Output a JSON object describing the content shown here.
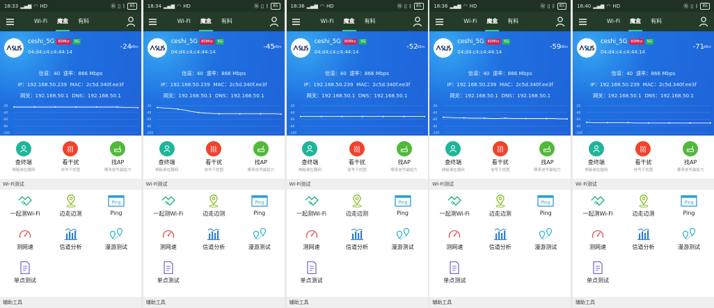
{
  "panels": [
    {
      "status": {
        "time": "18:33",
        "network": "HD",
        "battery": "85"
      },
      "tabs": [
        "Wi-Fi",
        "魔盒",
        "有料"
      ],
      "active_tab": 1,
      "network": {
        "ssid": "ceshi_5G",
        "width_badge": "80Mhz",
        "band_badge": "5G",
        "mac": "04:d4:c4:c4:44:14",
        "rssi": "-24",
        "rssi_unit": "dBm",
        "channel_label": "信道：",
        "channel": "40",
        "rate_label": "速率：",
        "rate": "866 Mbps",
        "ip_label": "IP：",
        "ip": "192.168.50.239",
        "mac_label": "MAC：",
        "bssid": "2c5d.340f.ee3f",
        "gw_label": "网关：",
        "gateway": "192.168.50.1",
        "dns_label": "DNS：",
        "dns": "192.168.50.1"
      },
      "chart_data": {
        "type": "line",
        "y_ticks": [
          "-20",
          "-40",
          "-60",
          "-80",
          "-100"
        ],
        "ylim": [
          -100,
          -20
        ],
        "values": [
          -24,
          -24,
          -24,
          -24,
          -24,
          -24,
          -24,
          -24,
          -24,
          -24,
          -24,
          -24,
          -24,
          -24,
          -24,
          -24,
          -25,
          -25,
          -26
        ]
      }
    },
    {
      "status": {
        "time": "18:34",
        "network": "HD",
        "battery": "85"
      },
      "tabs": [
        "Wi-Fi",
        "魔盒",
        "有料"
      ],
      "active_tab": 1,
      "network": {
        "ssid": "ceshi_5G",
        "width_badge": "80Mhz",
        "band_badge": "5G",
        "mac": "04:d4:c4:c4:44:14",
        "rssi": "-45",
        "rssi_unit": "dBm",
        "channel_label": "信道：",
        "channel": "40",
        "rate_label": "速率：",
        "rate": "866 Mbps",
        "ip_label": "IP：",
        "ip": "192.168.50.239",
        "mac_label": "MAC：",
        "bssid": "2c5d.340f.ee3f",
        "gw_label": "网关：",
        "gateway": "192.168.50.1",
        "dns_label": "DNS：",
        "dns": "192.168.50.1"
      },
      "chart_data": {
        "type": "line",
        "y_ticks": [
          "-20",
          "-40",
          "-60",
          "-80",
          "-100"
        ],
        "ylim": [
          -100,
          -20
        ],
        "values": [
          -25,
          -27,
          -28,
          -30,
          -33,
          -37,
          -40,
          -42,
          -43,
          -44,
          -44,
          -44,
          -44,
          -44,
          -44,
          -44,
          -44,
          -44,
          -45
        ]
      }
    },
    {
      "status": {
        "time": "18:36",
        "network": "HD",
        "battery": "85"
      },
      "tabs": [
        "Wi-Fi",
        "魔盒",
        "有料"
      ],
      "active_tab": 1,
      "network": {
        "ssid": "ceshi_5G",
        "width_badge": "80Mhz",
        "band_badge": "5G",
        "mac": "04:d4:c4:c4:44:14",
        "rssi": "-52",
        "rssi_unit": "dBm",
        "channel_label": "信道：",
        "channel": "40",
        "rate_label": "速率：",
        "rate": "866 Mbps",
        "ip_label": "IP：",
        "ip": "192.168.50.239",
        "mac_label": "MAC：",
        "bssid": "2c5d.340f.ee3f",
        "gw_label": "网关：",
        "gateway": "192.168.50.1",
        "dns_label": "DNS：",
        "dns": "192.168.50.1"
      },
      "chart_data": {
        "type": "line",
        "y_ticks": [
          "-20",
          "-40",
          "-60",
          "-80",
          "-100"
        ],
        "ylim": [
          -100,
          -20
        ],
        "values": [
          -52,
          -52,
          -52,
          -52,
          -52,
          -52,
          -52,
          -52,
          -52,
          -52,
          -52,
          -52,
          -52,
          -52,
          -52,
          -52,
          -52,
          -52,
          -52
        ]
      }
    },
    {
      "status": {
        "time": "18:36",
        "network": "HD",
        "battery": "85"
      },
      "tabs": [
        "Wi-Fi",
        "魔盒",
        "有料"
      ],
      "active_tab": 1,
      "network": {
        "ssid": "ceshi_5G",
        "width_badge": "80Mhz",
        "band_badge": "5G",
        "mac": "04:d4:c4:c4:44:14",
        "rssi": "-59",
        "rssi_unit": "dBm",
        "channel_label": "信道：",
        "channel": "40",
        "rate_label": "速率：",
        "rate": "866 Mbps",
        "ip_label": "IP：",
        "ip": "192.168.50.239",
        "mac_label": "MAC：",
        "bssid": "2c5d.340f.ee3f",
        "gw_label": "网关：",
        "gateway": "192.168.50.1",
        "dns_label": "DNS：",
        "dns": "192.168.50.1"
      },
      "chart_data": {
        "type": "line",
        "y_ticks": [
          "-20",
          "-40",
          "-60",
          "-80",
          "-100"
        ],
        "ylim": [
          -100,
          -20
        ],
        "values": [
          -54,
          -55,
          -56,
          -56,
          -57,
          -57,
          -57,
          -58,
          -58,
          -57,
          -58,
          -58,
          -58,
          -58,
          -58,
          -58,
          -58,
          -59,
          -59
        ]
      }
    },
    {
      "status": {
        "time": "18:40",
        "network": "HD",
        "battery": "85"
      },
      "tabs": [
        "Wi-Fi",
        "魔盒",
        "有料"
      ],
      "active_tab": 1,
      "network": {
        "ssid": "ceshi_5G",
        "width_badge": "80Mhz",
        "band_badge": "5G",
        "mac": "04:d4:c4:c4:44:14",
        "rssi": "-71",
        "rssi_unit": "dBm",
        "channel_label": "信道：",
        "channel": "40",
        "rate_label": "速率：",
        "rate": "866 Mbps",
        "ip_label": "IP：",
        "ip": "192.168.50.239",
        "mac_label": "MAC：",
        "bssid": "2c5d.340f.ee3f",
        "gw_label": "网关：",
        "gateway": "192.168.50.1",
        "dns_label": "DNS：",
        "dns": "192.168.50.1"
      },
      "chart_data": {
        "type": "line",
        "y_ticks": [
          "-20",
          "-40",
          "-60",
          "-80",
          "-100"
        ],
        "ylim": [
          -100,
          -20
        ],
        "values": [
          -69,
          -70,
          -70,
          -70,
          -70,
          -70,
          -70,
          -71,
          -71,
          -71,
          -71,
          -71,
          -71,
          -71,
          -71,
          -71,
          -71,
          -71,
          -71
        ]
      }
    }
  ],
  "features": [
    {
      "title": "查终端",
      "subtitle": "揭秘谁在蹭网",
      "color": "#1fb59a",
      "icon": "user-icon"
    },
    {
      "title": "看干扰",
      "subtitle": "信号干扰图",
      "color": "#f0432e",
      "icon": "interference-icon"
    },
    {
      "title": "找AP",
      "subtitle": "哪来信号最给力",
      "color": "#52b83a",
      "icon": "router-icon"
    }
  ],
  "wifi_section_title": "Wi-Fi测试",
  "tools": [
    {
      "label": "一起测Wi-Fi",
      "icon": "handshake-icon"
    },
    {
      "label": "边走边测",
      "icon": "location-pin-icon"
    },
    {
      "label": "Ping",
      "icon": "ping-window-icon"
    },
    {
      "label": "测网速",
      "icon": "speed-gauge-icon"
    },
    {
      "label": "信道分析",
      "icon": "bar-chart-icon"
    },
    {
      "label": "漫游测试",
      "icon": "roaming-pins-icon"
    },
    {
      "label": "单点测试",
      "icon": "document-icon"
    }
  ],
  "aux_section_title": "辅助工具",
  "colors": {
    "statusbar": "#1f3124",
    "topbar": "#243b29",
    "hero": "#1f63d8",
    "tab_indicator": "#3ad37a",
    "tool_icon": "#2a9cd8"
  }
}
